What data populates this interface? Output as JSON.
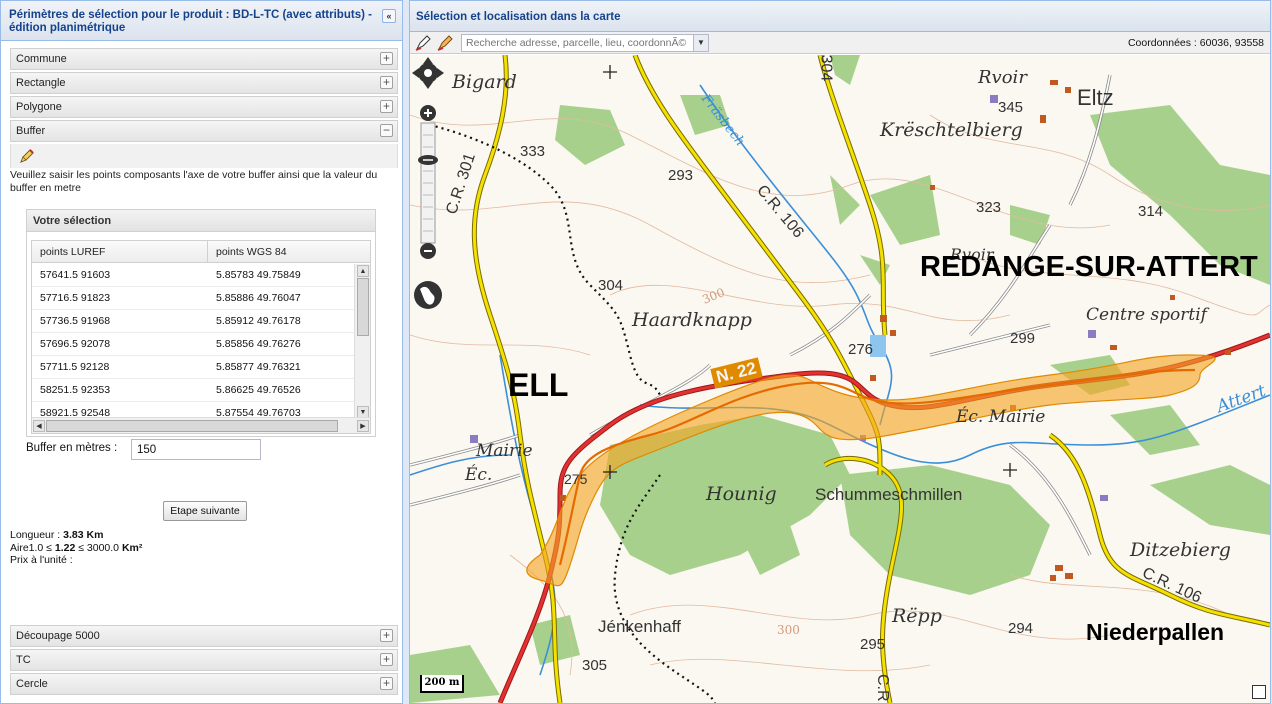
{
  "left_panel": {
    "title": "Périmètres de sélection pour le produit : BD-L-TC (avec attributs) - édition planimétrique",
    "collapse_icon": "«",
    "sections_top": [
      {
        "label": "Commune",
        "icon": "+"
      },
      {
        "label": "Rectangle",
        "icon": "+"
      },
      {
        "label": "Polygone",
        "icon": "+"
      },
      {
        "label": "Buffer",
        "icon": "−"
      }
    ],
    "instructions": "Veuillez saisir les points composants l'axe de votre buffer ainsi que la valeur du buffer en metre",
    "selection": {
      "title": "Votre sélection",
      "columns": [
        "points LUREF",
        "points WGS 84"
      ],
      "rows": [
        [
          "57641.5 91603",
          "5.85783 49.75849"
        ],
        [
          "57716.5 91823",
          "5.85886 49.76047"
        ],
        [
          "57736.5 91968",
          "5.85912 49.76178"
        ],
        [
          "57696.5 92078",
          "5.85856 49.76276"
        ],
        [
          "57711.5 92128",
          "5.85877 49.76321"
        ],
        [
          "58251.5 92353",
          "5.86625 49.76526"
        ],
        [
          "58921.5 92548",
          "5.87554 49.76703"
        ]
      ]
    },
    "buffer_label": "Buffer en mètres :",
    "buffer_value": "150",
    "next_button": "Etape suivante",
    "length_label": "Longueur : ",
    "length_value": "3.83 Km",
    "area_prefix": "Aire1.0 ≤ ",
    "area_value": "1.22",
    "area_suffix": " ≤ 3000.0 ",
    "area_unit": "Km²",
    "price_label": "Prix à l'unité :",
    "sections_bottom": [
      {
        "label": "Découpage 5000",
        "icon": "+"
      },
      {
        "label": "TC",
        "icon": "+"
      },
      {
        "label": "Cercle",
        "icon": "+"
      }
    ]
  },
  "right_panel": {
    "title": "Sélection et localisation dans la carte",
    "search_placeholder": "Recherche adresse, parcelle, lieu, coordonnÃ©",
    "coordinates": "Coordonnées : 60036, 93558"
  },
  "map": {
    "scale_label": "200 m",
    "labels": {
      "bigard": "Bigard",
      "rvoir_top": "Rvoir",
      "n345": "345",
      "eltz": "Eltz",
      "frasbech": "Fräsbech",
      "kreschtelbierg": "Krëschtelbierg",
      "n333": "333",
      "cr301": "C.R. 301",
      "n293": "293",
      "cr106_top": "C.R. 106",
      "n323": "323",
      "n314": "314",
      "rvoir_mid": "Rvoir",
      "redange": "REDANGE-SUR-ATTERT",
      "n304": "304",
      "n300_a": "300",
      "haardknapp": "Haardknapp",
      "n299": "299",
      "centre_sportif": "Centre sportif",
      "n276": "276",
      "ell": "ELL",
      "n22": "N. 22",
      "ec_mairie_right": "Éc. Mairie",
      "attert": "Attert",
      "mairie_left": "Mairie",
      "ec_left": "Éc.",
      "n275": "275",
      "hounig": "Hounig",
      "schummeschmillen": "Schummeschmillen",
      "ditzebierg": "Ditzebierg",
      "cr106_bottom": "C.R. 106",
      "jenkenhaff": "Jénkenhaff",
      "n300_b": "300",
      "repp": "Rëpp",
      "n294": "294",
      "niederpallen": "Niederpallen",
      "n295": "295",
      "n305": "305",
      "n304_road": "304",
      "cr_bottom": "C.R."
    }
  },
  "colors": {
    "panel_header": "#15428b",
    "buffer_fill": "#f5a623",
    "road_yellow": "#f5e100",
    "road_red": "#e53030",
    "forest": "#a8d08d",
    "water": "#3b8fd8"
  }
}
